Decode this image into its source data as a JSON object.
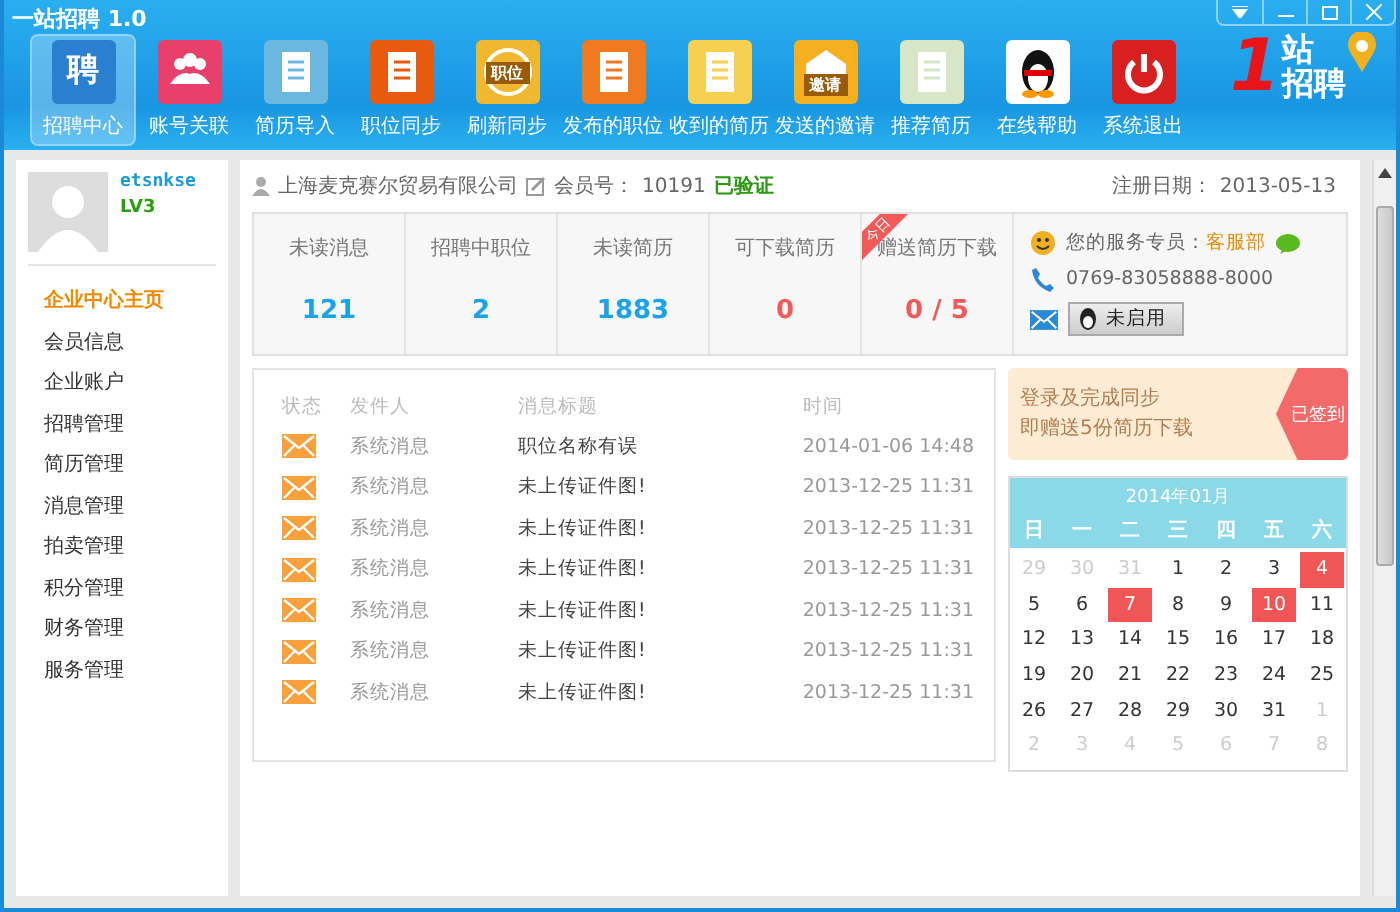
{
  "window": {
    "title": "一站招聘 1.0"
  },
  "toolbar": [
    {
      "label": "招聘中心",
      "selected": true,
      "icon_text": "聘"
    },
    {
      "label": "账号关联",
      "selected": false
    },
    {
      "label": "简历导入",
      "selected": false
    },
    {
      "label": "职位同步",
      "selected": false
    },
    {
      "label": "刷新同步",
      "selected": false,
      "icon_text": "职位"
    },
    {
      "label": "发布的职位",
      "selected": false
    },
    {
      "label": "收到的简历",
      "selected": false
    },
    {
      "label": "发送的邀请",
      "selected": false,
      "icon_text": "邀请"
    },
    {
      "label": "推荐简历",
      "selected": false
    },
    {
      "label": "在线帮助",
      "selected": false
    },
    {
      "label": "系统退出",
      "selected": false
    }
  ],
  "brand": {
    "numeral": "1",
    "line_1": "站",
    "line_2": "招聘"
  },
  "user": {
    "name": "etsnkse",
    "level": "LV3"
  },
  "sidebar": {
    "items": [
      {
        "label": "企业中心主页",
        "selected": true
      },
      {
        "label": "会员信息",
        "selected": false
      },
      {
        "label": "企业账户",
        "selected": false
      },
      {
        "label": "招聘管理",
        "selected": false
      },
      {
        "label": "简历管理",
        "selected": false
      },
      {
        "label": "消息管理",
        "selected": false
      },
      {
        "label": "拍卖管理",
        "selected": false
      },
      {
        "label": "积分管理",
        "selected": false
      },
      {
        "label": "财务管理",
        "selected": false
      },
      {
        "label": "服务管理",
        "selected": false
      }
    ]
  },
  "header": {
    "company": "上海麦克赛尔贸易有限公司",
    "member_label": "会员号：",
    "member_no": "10191",
    "verified": "已验证",
    "reg_label": "注册日期：",
    "reg_date": "2013-05-13"
  },
  "stats": [
    {
      "label": "未读消息",
      "value": "121",
      "color": "#1aa3e8"
    },
    {
      "label": "招聘中职位",
      "value": "2",
      "color": "#1aa3e8"
    },
    {
      "label": "未读简历",
      "value": "1883",
      "color": "#1aa3e8"
    },
    {
      "label": "可下载简历",
      "value": "0",
      "color": "#f25a5a"
    },
    {
      "label": "赠送简历下载",
      "value": "0 / 5",
      "color": "#f25a5a",
      "ribbon": "今日"
    }
  ],
  "service": {
    "agent_label": "您的服务专员：",
    "agent": "客服部",
    "phone": "0769-83058888-8000",
    "qq_button": "未启用"
  },
  "messages": {
    "columns": [
      "状态",
      "发件人",
      "消息标题",
      "时间"
    ],
    "rows": [
      {
        "sender": "系统消息",
        "title": "职位名称有误",
        "time": "2014-01-06 14:48"
      },
      {
        "sender": "系统消息",
        "title": "未上传证件图!",
        "time": "2013-12-25 11:31"
      },
      {
        "sender": "系统消息",
        "title": "未上传证件图!",
        "time": "2013-12-25 11:31"
      },
      {
        "sender": "系统消息",
        "title": "未上传证件图!",
        "time": "2013-12-25 11:31"
      },
      {
        "sender": "系统消息",
        "title": "未上传证件图!",
        "time": "2013-12-25 11:31"
      },
      {
        "sender": "系统消息",
        "title": "未上传证件图!",
        "time": "2013-12-25 11:31"
      },
      {
        "sender": "系统消息",
        "title": "未上传证件图!",
        "time": "2013-12-25 11:31"
      }
    ]
  },
  "signin": {
    "line_1": "登录及完成同步",
    "line_2": "即赠送5份简历下载",
    "badge": "已签到"
  },
  "calendar": {
    "title": "2014年01月",
    "weekdays": [
      "日",
      "一",
      "二",
      "三",
      "四",
      "五",
      "六"
    ],
    "days": [
      {
        "label": "29",
        "other": true,
        "marked": false
      },
      {
        "label": "30",
        "other": true,
        "marked": false
      },
      {
        "label": "31",
        "other": true,
        "marked": false
      },
      {
        "label": "1",
        "other": false,
        "marked": false
      },
      {
        "label": "2",
        "other": false,
        "marked": false
      },
      {
        "label": "3",
        "other": false,
        "marked": false
      },
      {
        "label": "4",
        "other": false,
        "marked": true
      },
      {
        "label": "5",
        "other": false,
        "marked": false
      },
      {
        "label": "6",
        "other": false,
        "marked": false
      },
      {
        "label": "7",
        "other": false,
        "marked": true
      },
      {
        "label": "8",
        "other": false,
        "marked": false
      },
      {
        "label": "9",
        "other": false,
        "marked": false
      },
      {
        "label": "10",
        "other": false,
        "marked": true
      },
      {
        "label": "11",
        "other": false,
        "marked": false
      },
      {
        "label": "12",
        "other": false,
        "marked": false
      },
      {
        "label": "13",
        "other": false,
        "marked": false
      },
      {
        "label": "14",
        "other": false,
        "marked": false
      },
      {
        "label": "15",
        "other": false,
        "marked": false
      },
      {
        "label": "16",
        "other": false,
        "marked": false
      },
      {
        "label": "17",
        "other": false,
        "marked": false
      },
      {
        "label": "18",
        "other": false,
        "marked": false
      },
      {
        "label": "19",
        "other": false,
        "marked": false
      },
      {
        "label": "20",
        "other": false,
        "marked": false
      },
      {
        "label": "21",
        "other": false,
        "marked": false
      },
      {
        "label": "22",
        "other": false,
        "marked": false
      },
      {
        "label": "23",
        "other": false,
        "marked": false
      },
      {
        "label": "24",
        "other": false,
        "marked": false
      },
      {
        "label": "25",
        "other": false,
        "marked": false
      },
      {
        "label": "26",
        "other": false,
        "marked": false
      },
      {
        "label": "27",
        "other": false,
        "marked": false
      },
      {
        "label": "28",
        "other": false,
        "marked": false
      },
      {
        "label": "29",
        "other": false,
        "marked": false
      },
      {
        "label": "30",
        "other": false,
        "marked": false
      },
      {
        "label": "31",
        "other": false,
        "marked": false
      },
      {
        "label": "1",
        "other": true,
        "marked": false
      },
      {
        "label": "2",
        "other": true,
        "marked": false
      },
      {
        "label": "3",
        "other": true,
        "marked": false
      },
      {
        "label": "4",
        "other": true,
        "marked": false
      },
      {
        "label": "5",
        "other": true,
        "marked": false
      },
      {
        "label": "6",
        "other": true,
        "marked": false
      },
      {
        "label": "7",
        "other": true,
        "marked": false
      },
      {
        "label": "8",
        "other": true,
        "marked": false
      }
    ]
  }
}
